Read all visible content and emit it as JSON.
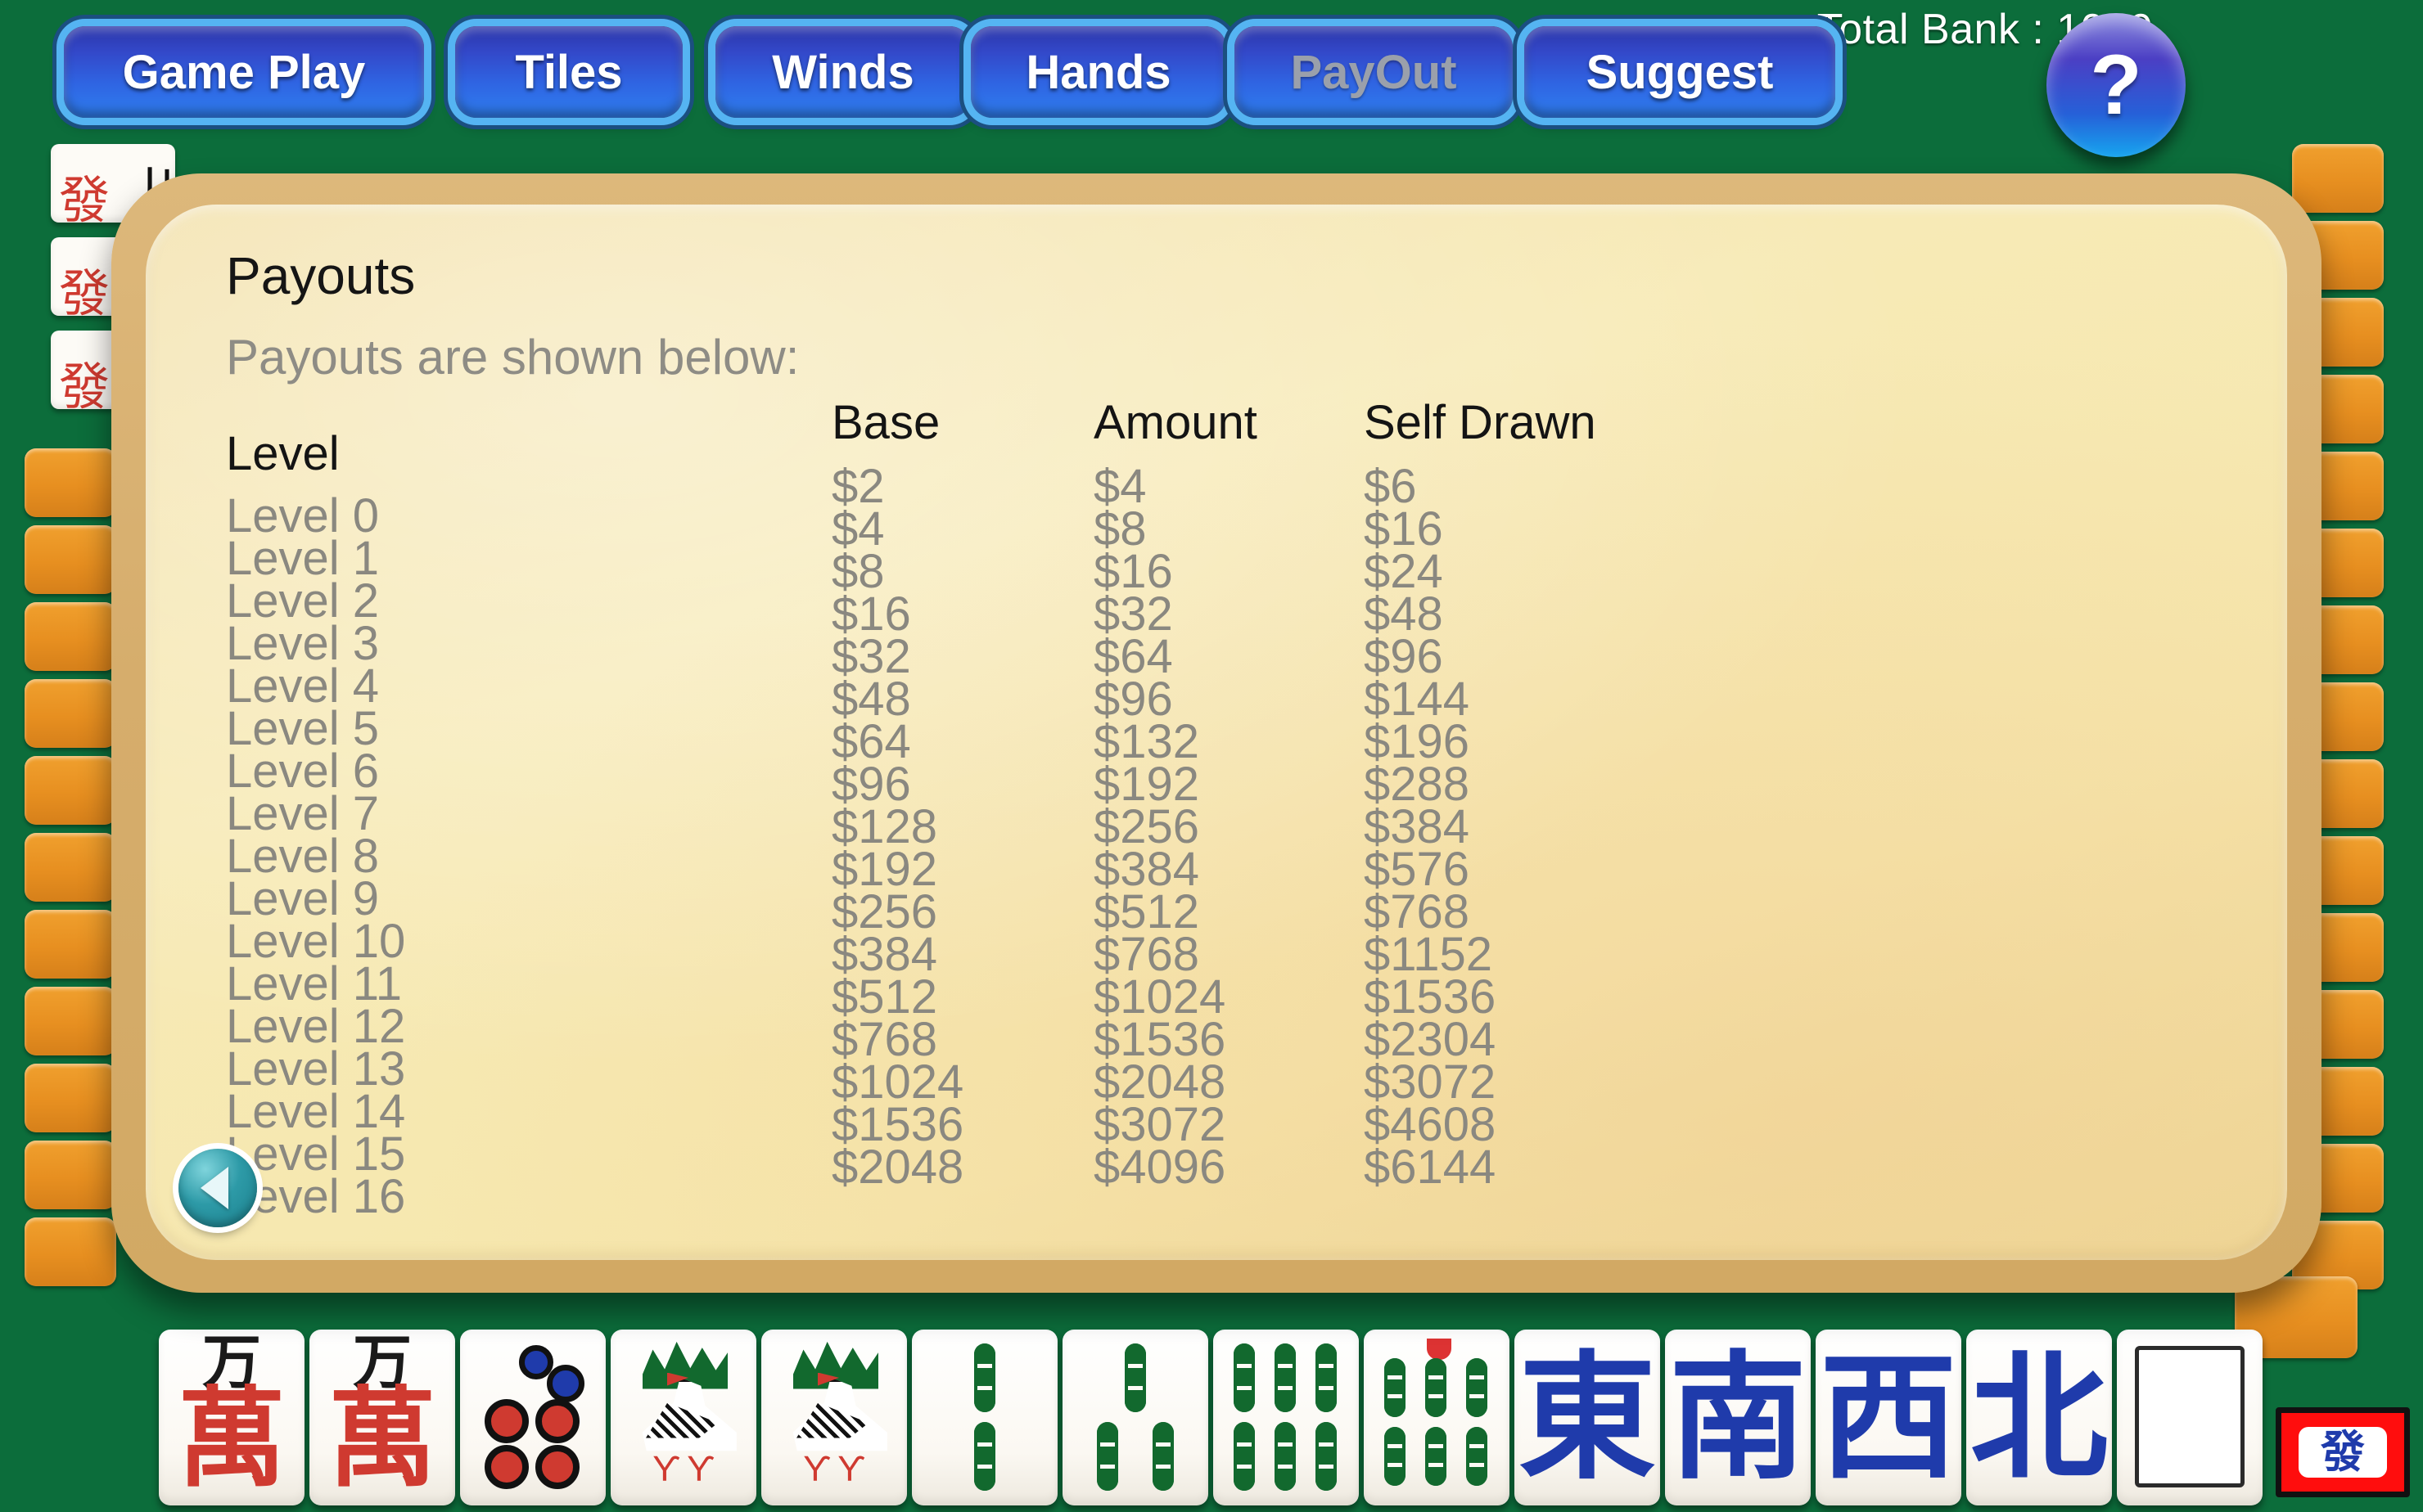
{
  "header": {
    "status_text": "Total Bank : 1000",
    "help_label": "?",
    "buttons": [
      {
        "id": "gameplay",
        "label": "Game Play",
        "state": "enabled"
      },
      {
        "id": "tiles",
        "label": "Tiles",
        "state": "enabled"
      },
      {
        "id": "winds",
        "label": "Winds",
        "state": "enabled"
      },
      {
        "id": "hands",
        "label": "Hands",
        "state": "enabled"
      },
      {
        "id": "payout",
        "label": "PayOut",
        "state": "active"
      },
      {
        "id": "suggest",
        "label": "Suggest",
        "state": "enabled"
      }
    ]
  },
  "dialog": {
    "title": "Payouts",
    "subtitle": "Payouts are shown below:",
    "back_label": "back-arrow",
    "columns": [
      "Level",
      "Base",
      "Amount",
      "Self Drawn"
    ],
    "levels": [
      "Level 0",
      "Level 1",
      "Level 2",
      "Level 3",
      "Level 4",
      "Level 5",
      "Level 6",
      "Level 7",
      "Level 8",
      "Level 9",
      "Level 10",
      "Level 11",
      "Level 12",
      "Level 13",
      "Level 14",
      "Level 15",
      "Level 16"
    ],
    "base": [
      "$2",
      "$4",
      "$8",
      "$16",
      "$32",
      "$48",
      "$64",
      "$96",
      "$128",
      "$192",
      "$256",
      "$384",
      "$512",
      "$768",
      "$1024",
      "$1536",
      "$2048"
    ],
    "amount": [
      "$4",
      "$8",
      "$16",
      "$32",
      "$64",
      "$96",
      "$132",
      "$192",
      "$256",
      "$384",
      "$512",
      "$768",
      "$1024",
      "$1536",
      "$2048",
      "$3072",
      "$4096"
    ],
    "self_drawn": [
      "$6",
      "$16",
      "$24",
      "$48",
      "$96",
      "$144",
      "$196",
      "$288",
      "$384",
      "$576",
      "$768",
      "$1152",
      "$1536",
      "$2304",
      "$3072",
      "$4608",
      "$6144"
    ]
  },
  "hand": {
    "tiles": [
      {
        "type": "character",
        "value": "萬",
        "rank": "",
        "name": "tile-character-wan-a"
      },
      {
        "type": "character",
        "value": "萬",
        "rank": "",
        "name": "tile-character-wan-b"
      },
      {
        "type": "dots",
        "value": "5",
        "name": "tile-dots-5"
      },
      {
        "type": "bamboo-bird",
        "value": "1",
        "name": "tile-bamboo-1-a"
      },
      {
        "type": "bamboo-bird",
        "value": "1",
        "name": "tile-bamboo-1-b"
      },
      {
        "type": "bamboo",
        "value": "2",
        "name": "tile-bamboo-2"
      },
      {
        "type": "bamboo",
        "value": "3",
        "name": "tile-bamboo-3"
      },
      {
        "type": "bamboo",
        "value": "6",
        "name": "tile-bamboo-6"
      },
      {
        "type": "bamboo",
        "value": "7",
        "name": "tile-bamboo-7"
      },
      {
        "type": "wind",
        "value": "東",
        "name": "tile-wind-east"
      },
      {
        "type": "wind",
        "value": "南",
        "name": "tile-wind-south"
      },
      {
        "type": "wind",
        "value": "西",
        "name": "tile-wind-west"
      },
      {
        "type": "wind",
        "value": "北",
        "name": "tile-wind-north"
      },
      {
        "type": "blank",
        "value": "",
        "name": "tile-blank"
      }
    ]
  },
  "indicator": {
    "glyph": "發",
    "border_color": "#ff0d0d"
  },
  "colors": {
    "felt_green": "#0c6d3b",
    "tile_back_orange": "#e78f20",
    "dialog_border": "#d6ad6c",
    "dialog_fill": "#f6e7ad",
    "button_blue": "#2f64e2",
    "button_glow": "#55b4f2",
    "value_gray": "#8a8880",
    "header_black": "#141414",
    "back_button_teal": "#2d9aa7"
  }
}
